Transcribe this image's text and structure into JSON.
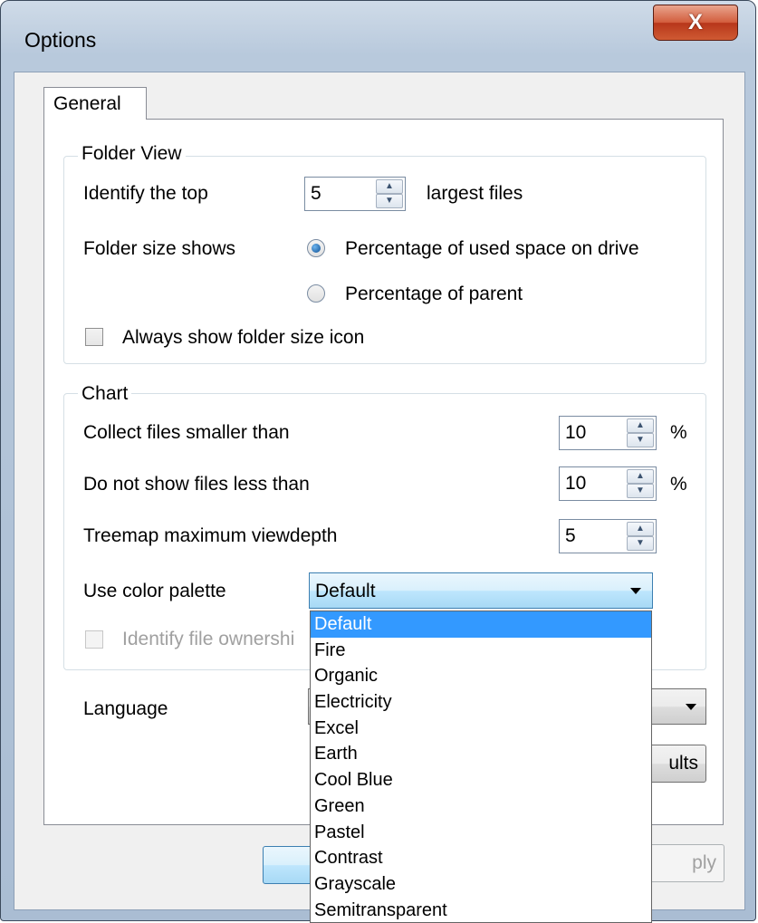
{
  "window": {
    "title": "Options",
    "close_glyph": "X"
  },
  "tabs": [
    {
      "label": "General"
    }
  ],
  "folder_view": {
    "title": "Folder View",
    "top_label": "Identify the top",
    "top_value": "5",
    "top_suffix": "largest files",
    "size_label": "Folder size shows",
    "radio_used_space": "Percentage of used space on drive",
    "radio_parent": "Percentage of parent",
    "always_show_icon": "Always show folder size icon"
  },
  "chart": {
    "title": "Chart",
    "collect_label": "Collect files smaller than",
    "collect_value": "10",
    "collect_unit": "%",
    "hide_label": "Do not show files less than",
    "hide_value": "10",
    "hide_unit": "%",
    "depth_label": "Treemap maximum viewdepth",
    "depth_value": "5",
    "palette_label": "Use color palette",
    "palette_value": "Default",
    "ownership_label": "Identify file ownershi"
  },
  "language_label": "Language",
  "defaults_button": "ults",
  "apply_button": "ply",
  "palette_options": [
    "Default",
    "Fire",
    "Organic",
    "Electricity",
    "Excel",
    "Earth",
    "Cool Blue",
    "Green",
    "Pastel",
    "Contrast",
    "Grayscale",
    "Semitransparent"
  ],
  "colors": {
    "selection": "#3399ff",
    "close": "#c9462a"
  }
}
